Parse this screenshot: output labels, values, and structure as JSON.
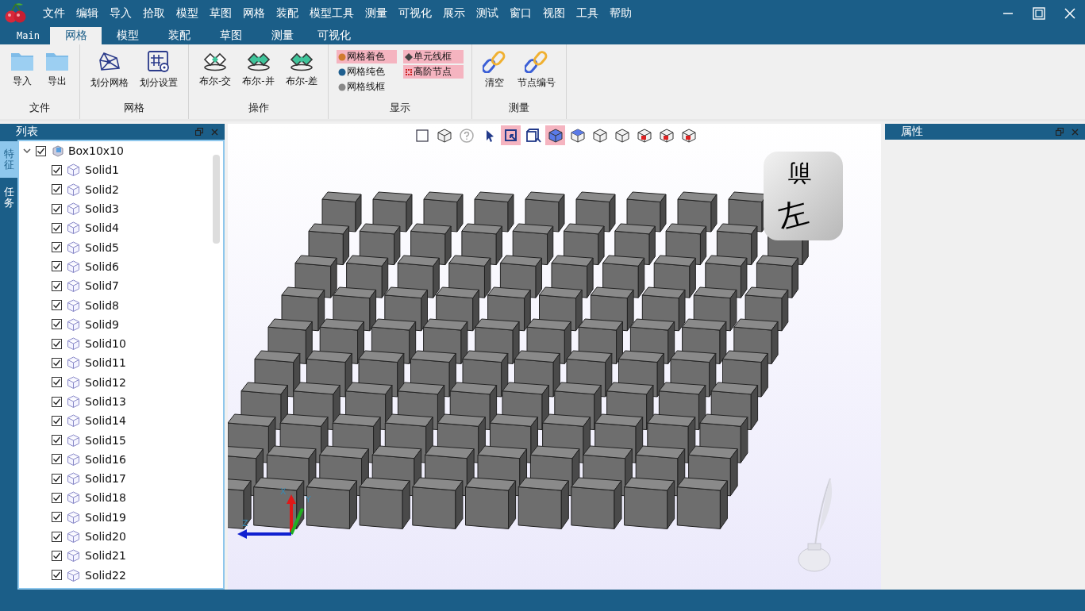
{
  "menu": [
    "文件",
    "编辑",
    "导入",
    "拾取",
    "模型",
    "草图",
    "网格",
    "装配",
    "模型工具",
    "测量",
    "可视化",
    "展示",
    "测试",
    "窗口",
    "视图",
    "工具",
    "帮助"
  ],
  "ribbon_tabs": [
    {
      "label": "Main",
      "selected": false
    },
    {
      "label": "网格",
      "selected": true
    },
    {
      "label": "模型",
      "selected": false
    },
    {
      "label": "装配",
      "selected": false
    },
    {
      "label": "草图",
      "selected": false
    },
    {
      "label": "测量",
      "selected": false
    },
    {
      "label": "可视化",
      "selected": false
    }
  ],
  "ribbon_groups": [
    {
      "kind": "buttons",
      "label": "文件",
      "buttons": [
        "导入",
        "导出"
      ]
    },
    {
      "kind": "buttons",
      "label": "网格",
      "buttons": [
        "划分网格",
        "划分设置"
      ]
    },
    {
      "kind": "buttons",
      "label": "操作",
      "buttons": [
        "布尔-交",
        "布尔-并",
        "布尔-差"
      ]
    },
    {
      "kind": "options",
      "label": "显示",
      "options": [
        {
          "label": "网格着色",
          "selected": true
        },
        {
          "label": "单元线框",
          "selected": true
        },
        {
          "label": "网格纯色",
          "selected": false
        },
        {
          "label": "高阶节点",
          "selected": true
        },
        {
          "label": "网格线框",
          "selected": false
        }
      ]
    },
    {
      "kind": "buttons",
      "label": "测量",
      "buttons": [
        "清空",
        "节点编号"
      ]
    }
  ],
  "left_panel": {
    "title": "列表",
    "side_tabs": [
      {
        "label": "特征",
        "selected": true
      },
      {
        "label": "任务",
        "selected": false
      }
    ],
    "tree": [
      {
        "label": "Box10x10",
        "checked": true,
        "expanded": true,
        "children": [
          {
            "label": "Solid1",
            "checked": true
          },
          {
            "label": "Solid2",
            "checked": true
          },
          {
            "label": "Solid3",
            "checked": true
          },
          {
            "label": "Solid4",
            "checked": true
          },
          {
            "label": "Solid5",
            "checked": true
          },
          {
            "label": "Solid6",
            "checked": true
          },
          {
            "label": "Solid7",
            "checked": true
          },
          {
            "label": "Solid8",
            "checked": true
          },
          {
            "label": "Solid9",
            "checked": true
          },
          {
            "label": "Solid10",
            "checked": true
          },
          {
            "label": "Solid11",
            "checked": true
          },
          {
            "label": "Solid12",
            "checked": true
          },
          {
            "label": "Solid13",
            "checked": true
          },
          {
            "label": "Solid14",
            "checked": true
          },
          {
            "label": "Solid15",
            "checked": true
          },
          {
            "label": "Solid16",
            "checked": true
          },
          {
            "label": "Solid17",
            "checked": true
          },
          {
            "label": "Solid18",
            "checked": true
          },
          {
            "label": "Solid19",
            "checked": true
          },
          {
            "label": "Solid20",
            "checked": true
          },
          {
            "label": "Solid21",
            "checked": true
          },
          {
            "label": "Solid22",
            "checked": true
          }
        ]
      }
    ]
  },
  "viewport": {
    "toolbar": [
      {
        "selected": false
      },
      {
        "selected": false
      },
      {
        "selected": false
      },
      {
        "selected": false
      },
      {
        "selected": true
      },
      {
        "selected": false
      },
      {
        "selected": true
      },
      {
        "selected": false
      },
      {
        "selected": false
      },
      {
        "selected": false
      },
      {
        "selected": false
      },
      {
        "selected": false
      },
      {
        "selected": false
      }
    ],
    "view_cube": {
      "top": "前",
      "front": "左"
    },
    "axes": [
      "X",
      "Y",
      "Z"
    ]
  },
  "right_panel": {
    "title": "属性"
  }
}
